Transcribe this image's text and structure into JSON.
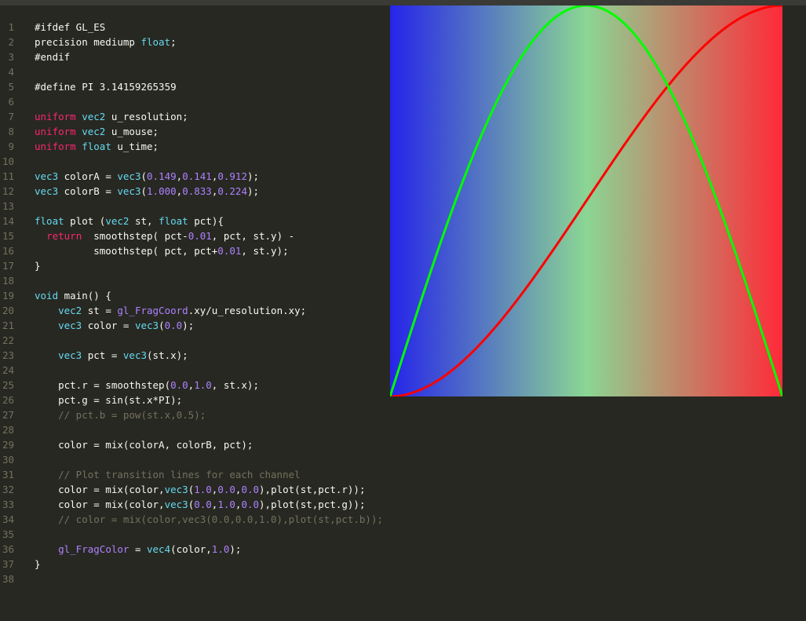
{
  "colors": {
    "background": "#272822",
    "line_number": "#75715e",
    "keyword": "#f92672",
    "type": "#66d9ef",
    "number": "#ae81ff",
    "comment": "#75715e",
    "text": "#f8f8f2",
    "colorA": "#2624e9",
    "colorB": "#ffd539",
    "plot_red": "#ff0000",
    "plot_green": "#00ff00"
  },
  "editor": {
    "lines": [
      {
        "n": "1",
        "t": [
          [
            "#ifdef GL_ES",
            ""
          ]
        ]
      },
      {
        "n": "2",
        "t": [
          [
            "precision mediump ",
            ""
          ],
          [
            "float",
            "ty"
          ],
          [
            ";",
            ""
          ]
        ]
      },
      {
        "n": "3",
        "t": [
          [
            "#endif",
            ""
          ]
        ]
      },
      {
        "n": "4",
        "t": []
      },
      {
        "n": "5",
        "t": [
          [
            "#define PI 3.14159265359",
            ""
          ]
        ]
      },
      {
        "n": "6",
        "t": []
      },
      {
        "n": "7",
        "t": [
          [
            "uniform",
            "kw"
          ],
          [
            " ",
            ""
          ],
          [
            "vec2",
            "ty"
          ],
          [
            " u_resolution;",
            ""
          ]
        ]
      },
      {
        "n": "8",
        "t": [
          [
            "uniform",
            "kw"
          ],
          [
            " ",
            ""
          ],
          [
            "vec2",
            "ty"
          ],
          [
            " u_mouse;",
            ""
          ]
        ]
      },
      {
        "n": "9",
        "t": [
          [
            "uniform",
            "kw"
          ],
          [
            " ",
            ""
          ],
          [
            "float",
            "ty"
          ],
          [
            " u_time;",
            ""
          ]
        ]
      },
      {
        "n": "10",
        "t": []
      },
      {
        "n": "11",
        "t": [
          [
            "vec3",
            "ty"
          ],
          [
            " colorA = ",
            ""
          ],
          [
            "vec3",
            "ty"
          ],
          [
            "(",
            ""
          ],
          [
            "0.149",
            "num"
          ],
          [
            ",",
            ""
          ],
          [
            "0.141",
            "num"
          ],
          [
            ",",
            ""
          ],
          [
            "0.912",
            "num"
          ],
          [
            ");",
            ""
          ]
        ]
      },
      {
        "n": "12",
        "t": [
          [
            "vec3",
            "ty"
          ],
          [
            " colorB = ",
            ""
          ],
          [
            "vec3",
            "ty"
          ],
          [
            "(",
            ""
          ],
          [
            "1.000",
            "num"
          ],
          [
            ",",
            ""
          ],
          [
            "0.833",
            "num"
          ],
          [
            ",",
            ""
          ],
          [
            "0.224",
            "num"
          ],
          [
            ");",
            ""
          ]
        ]
      },
      {
        "n": "13",
        "t": []
      },
      {
        "n": "14",
        "t": [
          [
            "float",
            "ty"
          ],
          [
            " plot (",
            ""
          ],
          [
            "vec2",
            "ty"
          ],
          [
            " st, ",
            ""
          ],
          [
            "float",
            "ty"
          ],
          [
            " pct){",
            ""
          ]
        ]
      },
      {
        "n": "15",
        "t": [
          [
            "  ",
            ""
          ],
          [
            "return",
            "kw"
          ],
          [
            "  smoothstep( pct-",
            ""
          ],
          [
            "0.01",
            "num"
          ],
          [
            ", pct, st.y) -",
            ""
          ]
        ]
      },
      {
        "n": "16",
        "t": [
          [
            "          smoothstep( pct, pct+",
            ""
          ],
          [
            "0.01",
            "num"
          ],
          [
            ", st.y);",
            ""
          ]
        ]
      },
      {
        "n": "17",
        "t": [
          [
            "}",
            ""
          ]
        ]
      },
      {
        "n": "18",
        "t": []
      },
      {
        "n": "19",
        "t": [
          [
            "void",
            "ty"
          ],
          [
            " main() {",
            ""
          ]
        ]
      },
      {
        "n": "20",
        "t": [
          [
            "    ",
            ""
          ],
          [
            "vec2",
            "ty"
          ],
          [
            " st = ",
            ""
          ],
          [
            "gl_FragCoord",
            "bi"
          ],
          [
            ".xy/u_resolution.xy;",
            ""
          ]
        ]
      },
      {
        "n": "21",
        "t": [
          [
            "    ",
            ""
          ],
          [
            "vec3",
            "ty"
          ],
          [
            " color = ",
            ""
          ],
          [
            "vec3",
            "ty"
          ],
          [
            "(",
            ""
          ],
          [
            "0.0",
            "num"
          ],
          [
            ");",
            ""
          ]
        ]
      },
      {
        "n": "22",
        "t": []
      },
      {
        "n": "23",
        "t": [
          [
            "    ",
            ""
          ],
          [
            "vec3",
            "ty"
          ],
          [
            " pct = ",
            ""
          ],
          [
            "vec3",
            "ty"
          ],
          [
            "(st.x);",
            ""
          ]
        ]
      },
      {
        "n": "24",
        "t": []
      },
      {
        "n": "25",
        "t": [
          [
            "    pct.r = smoothstep(",
            ""
          ],
          [
            "0.0",
            "num"
          ],
          [
            ",",
            ""
          ],
          [
            "1.0",
            "num"
          ],
          [
            ", st.x);",
            ""
          ]
        ]
      },
      {
        "n": "26",
        "t": [
          [
            "    pct.g = sin(st.x*PI);",
            ""
          ]
        ]
      },
      {
        "n": "27",
        "t": [
          [
            "    // pct.b = pow(st.x,0.5);",
            "cm"
          ]
        ]
      },
      {
        "n": "28",
        "t": []
      },
      {
        "n": "29",
        "t": [
          [
            "    color = mix(colorA, colorB, pct);",
            ""
          ]
        ]
      },
      {
        "n": "30",
        "t": []
      },
      {
        "n": "31",
        "t": [
          [
            "    // Plot transition lines for each channel",
            "cm"
          ]
        ]
      },
      {
        "n": "32",
        "t": [
          [
            "    color = mix(color,",
            ""
          ],
          [
            "vec3",
            "ty"
          ],
          [
            "(",
            ""
          ],
          [
            "1.0",
            "num"
          ],
          [
            ",",
            ""
          ],
          [
            "0.0",
            "num"
          ],
          [
            ",",
            ""
          ],
          [
            "0.0",
            "num"
          ],
          [
            "),plot(st,pct.r));",
            ""
          ]
        ]
      },
      {
        "n": "33",
        "t": [
          [
            "    color = mix(color,",
            ""
          ],
          [
            "vec3",
            "ty"
          ],
          [
            "(",
            ""
          ],
          [
            "0.0",
            "num"
          ],
          [
            ",",
            ""
          ],
          [
            "1.0",
            "num"
          ],
          [
            ",",
            ""
          ],
          [
            "0.0",
            "num"
          ],
          [
            "),plot(st,pct.g));",
            ""
          ]
        ]
      },
      {
        "n": "34",
        "t": [
          [
            "    // color = mix(color,vec3(0.0,0.0,1.0),plot(st,pct.b));",
            "cm"
          ]
        ]
      },
      {
        "n": "35",
        "t": []
      },
      {
        "n": "36",
        "t": [
          [
            "    ",
            ""
          ],
          [
            "gl_FragColor",
            "bi"
          ],
          [
            " = ",
            ""
          ],
          [
            "vec4",
            "ty"
          ],
          [
            "(color,",
            ""
          ],
          [
            "1.0",
            "num"
          ],
          [
            ");",
            ""
          ]
        ]
      },
      {
        "n": "37",
        "t": [
          [
            "}",
            ""
          ]
        ]
      },
      {
        "n": "38",
        "t": []
      }
    ]
  },
  "canvas": {
    "gradient_stops": [
      "#2624e9",
      "#8bd694",
      "#ff2a39"
    ]
  }
}
